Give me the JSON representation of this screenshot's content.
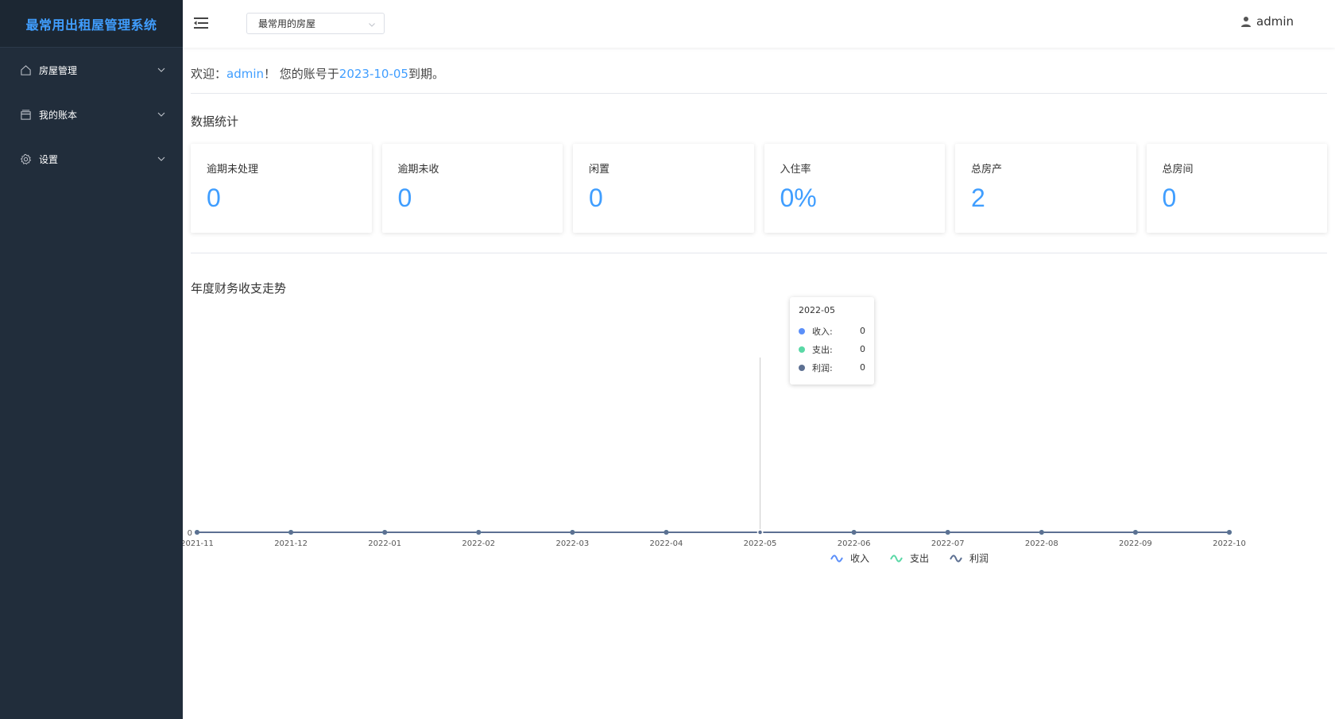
{
  "app": {
    "title": "最常用出租屋管理系统"
  },
  "sidebar": {
    "items": [
      {
        "label": "房屋管理",
        "icon": "home-icon"
      },
      {
        "label": "我的账本",
        "icon": "ledger-icon"
      },
      {
        "label": "设置",
        "icon": "gear-icon"
      }
    ]
  },
  "header": {
    "house_select": {
      "value": "最常用的房屋"
    },
    "user": {
      "name": "admin"
    }
  },
  "welcome": {
    "prefix": "欢迎：",
    "username": "admin",
    "middle": "！ 您的账号于",
    "expire_date": "2023-10-05",
    "suffix": "到期。"
  },
  "stats": {
    "title": "数据统计",
    "cards": [
      {
        "label": "逾期未处理",
        "value": "0"
      },
      {
        "label": "逾期未收",
        "value": "0"
      },
      {
        "label": "闲置",
        "value": "0"
      },
      {
        "label": "入住率",
        "value": "0%"
      },
      {
        "label": "总房产",
        "value": "2"
      },
      {
        "label": "总房间",
        "value": "0"
      }
    ]
  },
  "chart_data": {
    "type": "line",
    "title": "年度财务收支走势",
    "x": [
      "2021-11",
      "2021-12",
      "2022-01",
      "2022-02",
      "2022-03",
      "2022-04",
      "2022-05",
      "2022-06",
      "2022-07",
      "2022-08",
      "2022-09",
      "2022-10"
    ],
    "series": [
      {
        "name": "收入",
        "values": [
          0,
          0,
          0,
          0,
          0,
          0,
          0,
          0,
          0,
          0,
          0,
          0
        ],
        "color": "#5b8ff9"
      },
      {
        "name": "支出",
        "values": [
          0,
          0,
          0,
          0,
          0,
          0,
          0,
          0,
          0,
          0,
          0,
          0
        ],
        "color": "#5ad8a6"
      },
      {
        "name": "利润",
        "values": [
          0,
          0,
          0,
          0,
          0,
          0,
          0,
          0,
          0,
          0,
          0,
          0
        ],
        "color": "#5d7092"
      }
    ],
    "y_tick": "0",
    "legend_position": "bottom",
    "tooltip": {
      "title": "2022-05",
      "rows": [
        {
          "name": "收入:",
          "value": "0",
          "color": "#5b8ff9"
        },
        {
          "name": "支出:",
          "value": "0",
          "color": "#5ad8a6"
        },
        {
          "name": "利润:",
          "value": "0",
          "color": "#5d7092"
        }
      ]
    }
  }
}
